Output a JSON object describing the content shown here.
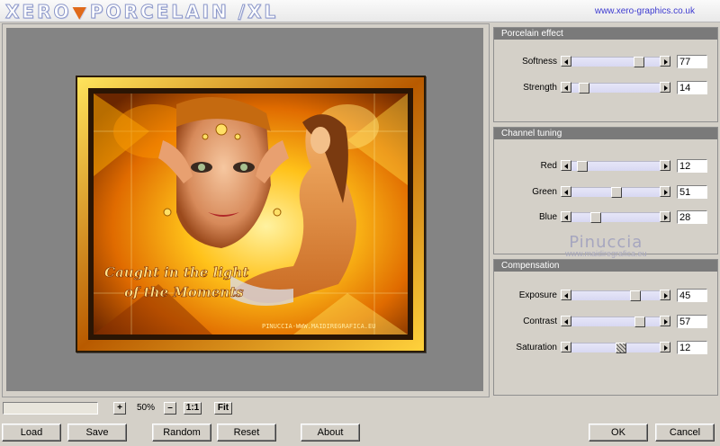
{
  "header": {
    "logo_part1": "XERO",
    "logo_part2": "PORCELAIN",
    "logo_part3": "/XL",
    "website": "www.xero-graphics.co.uk"
  },
  "preview": {
    "text_line1": "Caught in the light",
    "text_line2": "of the Moments",
    "signature": "PINUCCIA-WWW.MAIDIREGRAFICA.EU"
  },
  "panels": {
    "porcelain": {
      "title": "Porcelain effect",
      "sliders": [
        {
          "label": "Softness",
          "value": "77",
          "level_pct": 77
        },
        {
          "label": "Strength",
          "value": "14",
          "level_pct": 14
        }
      ]
    },
    "channel": {
      "title": "Channel tuning",
      "sliders": [
        {
          "label": "Red",
          "value": "12",
          "level_pct": 12
        },
        {
          "label": "Green",
          "value": "51",
          "level_pct": 51
        },
        {
          "label": "Blue",
          "value": "28",
          "level_pct": 28
        }
      ]
    },
    "compensation": {
      "title": "Compensation",
      "sliders": [
        {
          "label": "Exposure",
          "value": "45",
          "level_pct": 72
        },
        {
          "label": "Contrast",
          "value": "57",
          "level_pct": 78
        },
        {
          "label": "Saturation",
          "value": "12",
          "level_pct": 56
        }
      ]
    }
  },
  "watermark": {
    "name": "Pinuccia",
    "url": "www.maidiregrafica.eu"
  },
  "zoom": {
    "plus": "+",
    "value": "50%",
    "minus": "–",
    "one_to_one": "1:1",
    "fit": "Fit"
  },
  "buttons": {
    "load": "Load",
    "save": "Save",
    "random": "Random",
    "reset": "Reset",
    "about": "About",
    "ok": "OK",
    "cancel": "Cancel"
  }
}
